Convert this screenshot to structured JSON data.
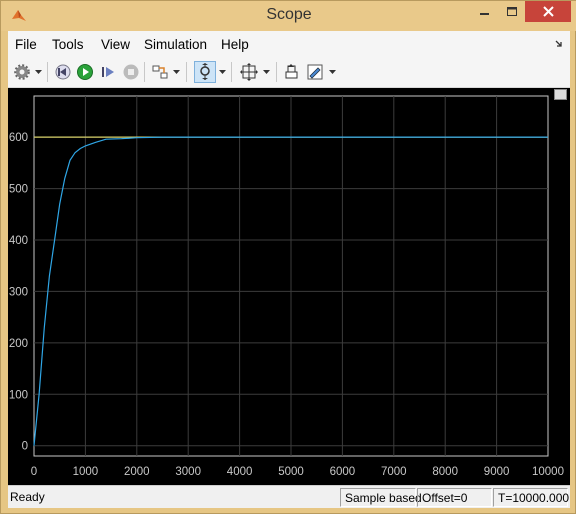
{
  "window": {
    "title": "Scope"
  },
  "menu": {
    "items": [
      "File",
      "Tools",
      "View",
      "Simulation",
      "Help"
    ]
  },
  "toolbar": {
    "icons": [
      "settings-icon",
      "step-back-icon",
      "run-icon",
      "step-forward-icon",
      "stop-icon",
      "signal-selection-icon",
      "zoom-icon",
      "fit-to-view-icon",
      "restore-style-icon",
      "edit-style-icon"
    ]
  },
  "colors": {
    "trace": "#2fa6e6",
    "reference": "#d8d26a",
    "grid": "#3c3c3c",
    "axes_bg": "#000000",
    "axes_fg": "#c8c8c8"
  },
  "chart_data": {
    "type": "line",
    "x_ticks": [
      "0",
      "1000",
      "2000",
      "3000",
      "4000",
      "5000",
      "6000",
      "7000",
      "8000",
      "9000",
      "10000"
    ],
    "y_ticks": [
      "0",
      "100",
      "200",
      "300",
      "400",
      "500",
      "600"
    ],
    "xlim": [
      0,
      10000
    ],
    "ylim": [
      -20,
      680
    ],
    "grid": true,
    "series": [
      {
        "x": [
          0,
          100,
          200,
          300,
          400,
          500,
          600,
          700,
          800,
          900,
          1000,
          1200,
          1400,
          1700,
          2000,
          2500,
          10000
        ],
        "y": [
          0,
          100,
          230,
          330,
          400,
          470,
          520,
          555,
          570,
          578,
          583,
          590,
          596,
          597,
          599,
          600,
          600
        ]
      },
      {
        "x": [
          0,
          10000
        ],
        "y": [
          600,
          600
        ]
      }
    ]
  },
  "status": {
    "ready": "Ready",
    "sample_mode": "Sample based",
    "offset": "Offset=0",
    "time": "T=10000.000"
  }
}
